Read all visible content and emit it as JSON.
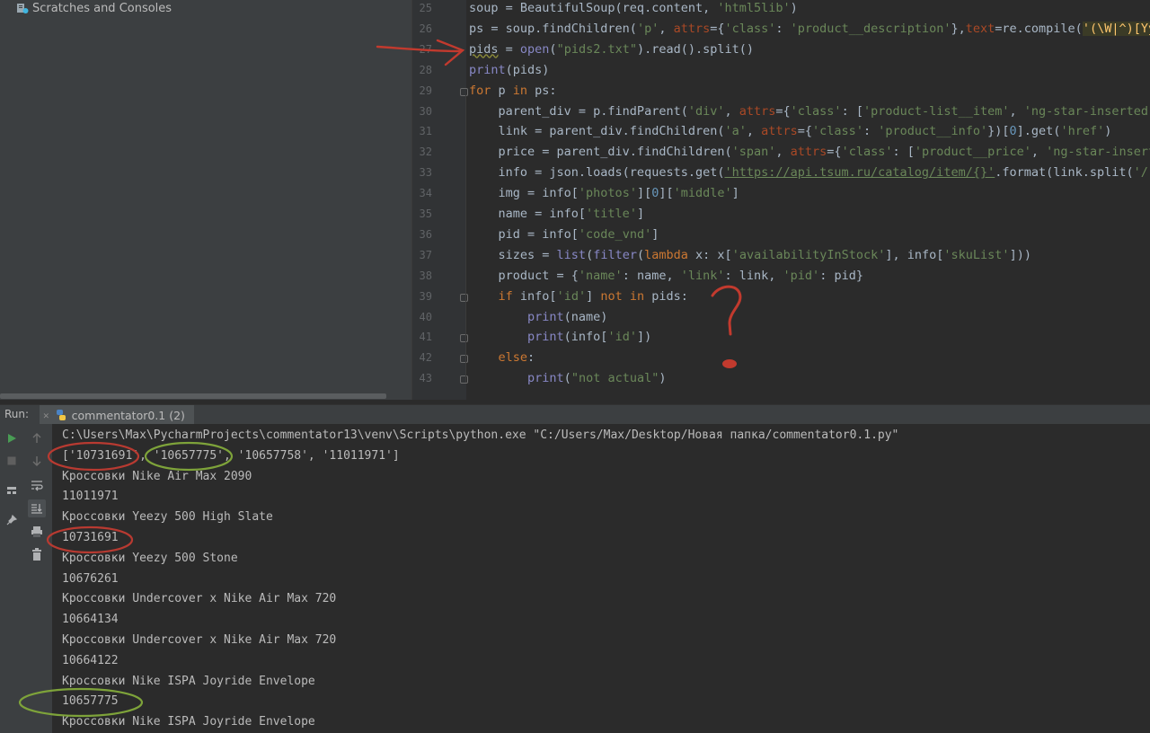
{
  "project": {
    "item_label": "Scratches and Consoles"
  },
  "editor": {
    "lines": [
      {
        "num": "25",
        "parts": [
          {
            "t": "soup = BeautifulSoup(req.content, "
          },
          {
            "t": "'html5lib'",
            "c": "s"
          },
          {
            "t": ")"
          }
        ]
      },
      {
        "num": "26",
        "parts": [
          {
            "t": "ps = soup.findChildren("
          },
          {
            "t": "'p'",
            "c": "s"
          },
          {
            "t": ", "
          },
          {
            "t": "attrs",
            "c": "p"
          },
          {
            "t": "={"
          },
          {
            "t": "'class'",
            "c": "s"
          },
          {
            "t": ": "
          },
          {
            "t": "'product__description'",
            "c": "s"
          },
          {
            "t": "},"
          },
          {
            "t": "text",
            "c": "p"
          },
          {
            "t": "=re.compile("
          },
          {
            "t": "'(\\W|^)[Yy]",
            "c": "rx"
          }
        ]
      },
      {
        "num": "27",
        "parts": [
          {
            "t": "pids",
            "c": "wv"
          },
          {
            "t": " = "
          },
          {
            "t": "open",
            "c": "f"
          },
          {
            "t": "("
          },
          {
            "t": "\"pids2.txt\"",
            "c": "s"
          },
          {
            "t": ").read().split()"
          }
        ]
      },
      {
        "num": "28",
        "parts": [
          {
            "t": "print",
            "c": "f"
          },
          {
            "t": "(pids)"
          }
        ]
      },
      {
        "num": "29",
        "parts": [
          {
            "t": "for",
            "c": "k"
          },
          {
            "t": " p "
          },
          {
            "t": "in",
            "c": "k"
          },
          {
            "t": " ps:"
          }
        ]
      },
      {
        "num": "30",
        "parts": [
          {
            "t": "    parent_div = p.findParent("
          },
          {
            "t": "'div'",
            "c": "s"
          },
          {
            "t": ", "
          },
          {
            "t": "attrs",
            "c": "p"
          },
          {
            "t": "={"
          },
          {
            "t": "'class'",
            "c": "s"
          },
          {
            "t": ": ["
          },
          {
            "t": "'product-list__item'",
            "c": "s"
          },
          {
            "t": ", "
          },
          {
            "t": "'ng-star-inserted'",
            "c": "s"
          },
          {
            "t": "]}"
          }
        ]
      },
      {
        "num": "31",
        "parts": [
          {
            "t": "    link = parent_div.findChildren("
          },
          {
            "t": "'a'",
            "c": "s"
          },
          {
            "t": ", "
          },
          {
            "t": "attrs",
            "c": "p"
          },
          {
            "t": "={"
          },
          {
            "t": "'class'",
            "c": "s"
          },
          {
            "t": ": "
          },
          {
            "t": "'product__info'",
            "c": "s"
          },
          {
            "t": "})["
          },
          {
            "t": "0",
            "c": "n"
          },
          {
            "t": "].get("
          },
          {
            "t": "'href'",
            "c": "s"
          },
          {
            "t": ")"
          }
        ]
      },
      {
        "num": "32",
        "parts": [
          {
            "t": "    price = parent_div.findChildren("
          },
          {
            "t": "'span'",
            "c": "s"
          },
          {
            "t": ", "
          },
          {
            "t": "attrs",
            "c": "p"
          },
          {
            "t": "={"
          },
          {
            "t": "'class'",
            "c": "s"
          },
          {
            "t": ": ["
          },
          {
            "t": "'product__price'",
            "c": "s"
          },
          {
            "t": ", "
          },
          {
            "t": "'ng-star-inserted'",
            "c": "s"
          }
        ]
      },
      {
        "num": "33",
        "parts": [
          {
            "t": "    info = json.loads(requests.get("
          },
          {
            "t": "'https://api.tsum.ru/catalog/item/{}'",
            "c": "sul"
          },
          {
            "t": ".format(link.split("
          },
          {
            "t": "'/'",
            "c": "s"
          },
          {
            "t": ")["
          }
        ]
      },
      {
        "num": "34",
        "parts": [
          {
            "t": "    img = info["
          },
          {
            "t": "'photos'",
            "c": "s"
          },
          {
            "t": "]["
          },
          {
            "t": "0",
            "c": "n"
          },
          {
            "t": "]["
          },
          {
            "t": "'middle'",
            "c": "s"
          },
          {
            "t": "]"
          }
        ]
      },
      {
        "num": "35",
        "parts": [
          {
            "t": "    name = info["
          },
          {
            "t": "'title'",
            "c": "s"
          },
          {
            "t": "]"
          }
        ]
      },
      {
        "num": "36",
        "parts": [
          {
            "t": "    pid = info["
          },
          {
            "t": "'code_vnd'",
            "c": "s"
          },
          {
            "t": "]"
          }
        ]
      },
      {
        "num": "37",
        "parts": [
          {
            "t": "    sizes = "
          },
          {
            "t": "list",
            "c": "f"
          },
          {
            "t": "("
          },
          {
            "t": "filter",
            "c": "f"
          },
          {
            "t": "("
          },
          {
            "t": "lambda",
            "c": "k"
          },
          {
            "t": " x: x["
          },
          {
            "t": "'availabilityInStock'",
            "c": "s"
          },
          {
            "t": "], info["
          },
          {
            "t": "'skuList'",
            "c": "s"
          },
          {
            "t": "]))"
          }
        ]
      },
      {
        "num": "38",
        "parts": [
          {
            "t": "    product = {"
          },
          {
            "t": "'name'",
            "c": "s"
          },
          {
            "t": ": name, "
          },
          {
            "t": "'link'",
            "c": "s"
          },
          {
            "t": ": link, "
          },
          {
            "t": "'pid'",
            "c": "s"
          },
          {
            "t": ": pid}"
          }
        ]
      },
      {
        "num": "39",
        "parts": [
          {
            "t": "    "
          },
          {
            "t": "if",
            "c": "k"
          },
          {
            "t": " info["
          },
          {
            "t": "'id'",
            "c": "s"
          },
          {
            "t": "] "
          },
          {
            "t": "not in",
            "c": "k"
          },
          {
            "t": " pids:"
          }
        ]
      },
      {
        "num": "40",
        "parts": [
          {
            "t": "        "
          },
          {
            "t": "print",
            "c": "f"
          },
          {
            "t": "(name)"
          }
        ]
      },
      {
        "num": "41",
        "parts": [
          {
            "t": "        "
          },
          {
            "t": "print",
            "c": "f"
          },
          {
            "t": "(info["
          },
          {
            "t": "'id'",
            "c": "s"
          },
          {
            "t": "])"
          }
        ]
      },
      {
        "num": "42",
        "parts": [
          {
            "t": "    "
          },
          {
            "t": "else",
            "c": "k"
          },
          {
            "t": ":"
          }
        ]
      },
      {
        "num": "43",
        "parts": [
          {
            "t": "        "
          },
          {
            "t": "print",
            "c": "f"
          },
          {
            "t": "("
          },
          {
            "t": "\"not actual\"",
            "c": "s"
          },
          {
            "t": ")"
          }
        ]
      }
    ]
  },
  "run": {
    "label": "Run:",
    "tab_label": "commentator0.1 (2)",
    "console_lines": [
      "C:\\Users\\Max\\PycharmProjects\\commentator13\\venv\\Scripts\\python.exe \"C:/Users/Max/Desktop/Новая папка/commentator0.1.py\"",
      "['10731691', '10657775', '10657758', '11011971']",
      "Кроссовки Nike Air Max 2090",
      "11011971",
      "Кроссовки Yeezy 500 High Slate",
      "10731691",
      "Кроссовки Yeezy 500 Stone",
      "10676261",
      "Кроссовки Undercover x Nike Air Max 720",
      "10664134",
      "Кроссовки Undercover x Nike Air Max 720",
      "10664122",
      "Кроссовки Nike ISPA Joyride Envelope",
      "10657775",
      "Кроссовки Nike ISPA Joyride Envelope"
    ]
  },
  "colors": {
    "keyword": "#cc7832",
    "string": "#6a8759",
    "builtin": "#8888c6",
    "number": "#6897bb",
    "param": "#aa4926",
    "run_green": "#499c54",
    "annot_red": "#c0392b",
    "annot_green": "#7ea33a"
  }
}
